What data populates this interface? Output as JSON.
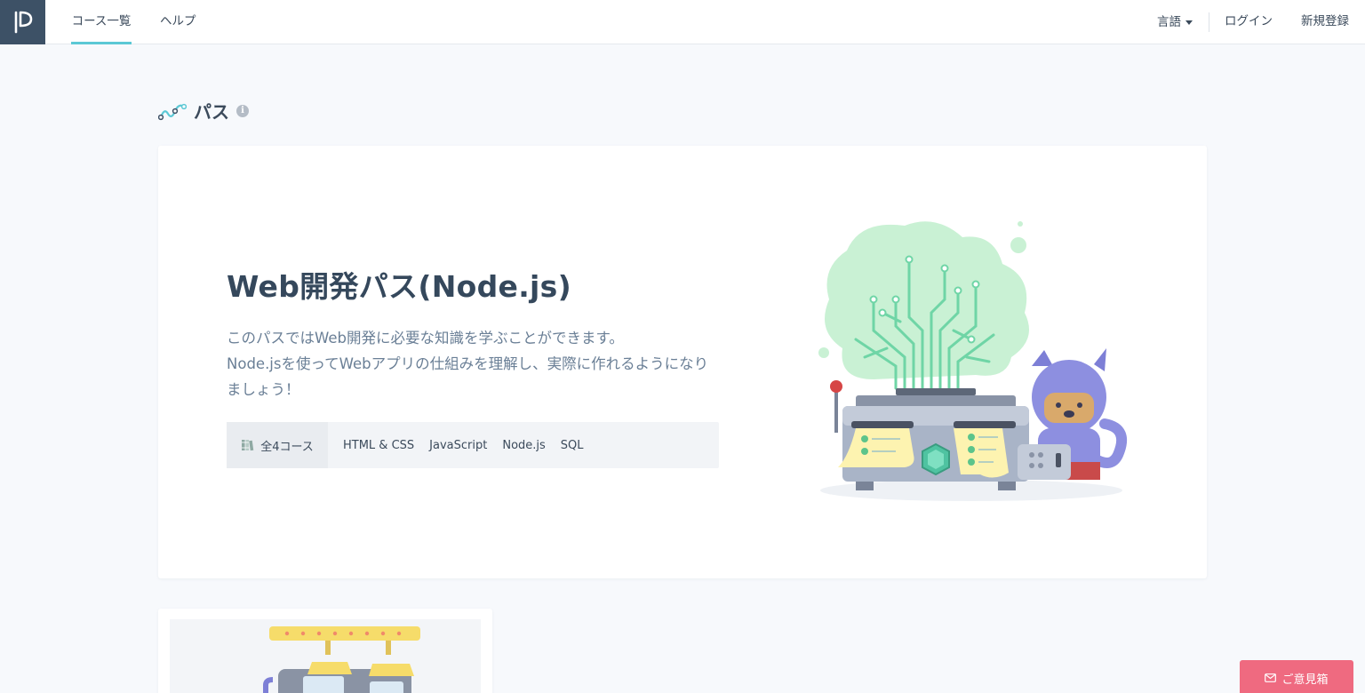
{
  "header": {
    "logo_icon": "progate-logo-icon",
    "nav": {
      "courses": "コース一覧",
      "help": "ヘルプ",
      "language": "言語",
      "login": "ログイン",
      "signup": "新規登録"
    }
  },
  "section": {
    "title": "パス",
    "icon": "path-icon",
    "info_icon": "i"
  },
  "path_card": {
    "title": "Web開発パス(Node.js)",
    "description_lines": [
      "このパスではWeb開発に必要な知識を学ぶことができます。",
      "Node.jsを使ってWebアプリの仕組みを理解し、実際に作れるようになり",
      "ましょう！"
    ],
    "course_count": "全4コース",
    "courses": [
      "HTML & CSS",
      "JavaScript",
      "Node.js",
      "SQL"
    ]
  },
  "feedback": {
    "label": "ご意見箱",
    "icon": "mail-icon"
  },
  "colors": {
    "accent": "#5bc8d5",
    "header_logo_bg": "#3d5166",
    "feedback": "#ef6a80",
    "title": "#35485c",
    "desc": "#6a7f96"
  }
}
